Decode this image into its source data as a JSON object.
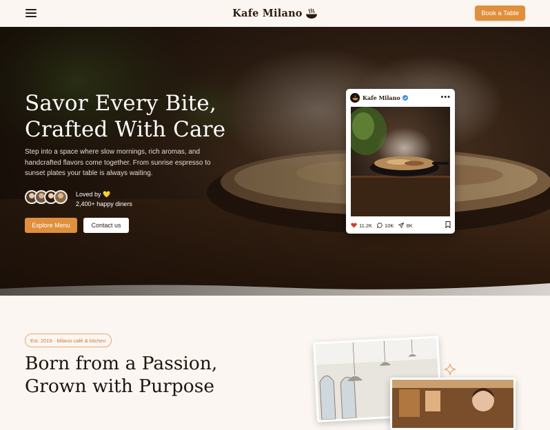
{
  "header": {
    "menu_icon": "hamburger-menu-icon",
    "brand_name": "Kafe Milano",
    "brand_icon": "steaming-bowl-icon",
    "cta_label": "Book a Table"
  },
  "hero": {
    "title_line1": "Savor Every Bite,",
    "title_line2": "Crafted With Care",
    "description": "Step into a space where slow mornings, rich aromas, and handcrafted flavors come together. From sunrise espresso to sunset plates your table is always waiting.",
    "loved_label": "Loved by",
    "loved_emoji": "💛",
    "diners_count": "2,400+ happy diners",
    "primary_button": "Explore Menu",
    "secondary_button": "Contact us"
  },
  "post": {
    "account_name": "Kafe Milano",
    "more_icon": "more-dots-icon",
    "likes": "11.2K",
    "comments": "10K",
    "shares": "8K",
    "save_icon": "bookmark-icon"
  },
  "about": {
    "badge": "Est. 2019 · Milano café & kitchen",
    "title_line1": "Born from a Passion,",
    "title_line2": "Grown with Purpose"
  },
  "colors": {
    "accent": "#e08f3c",
    "background": "#fbf6f1",
    "text": "#2a1c12",
    "heart": "#d43b2f",
    "verified": "#3b8fe0"
  }
}
